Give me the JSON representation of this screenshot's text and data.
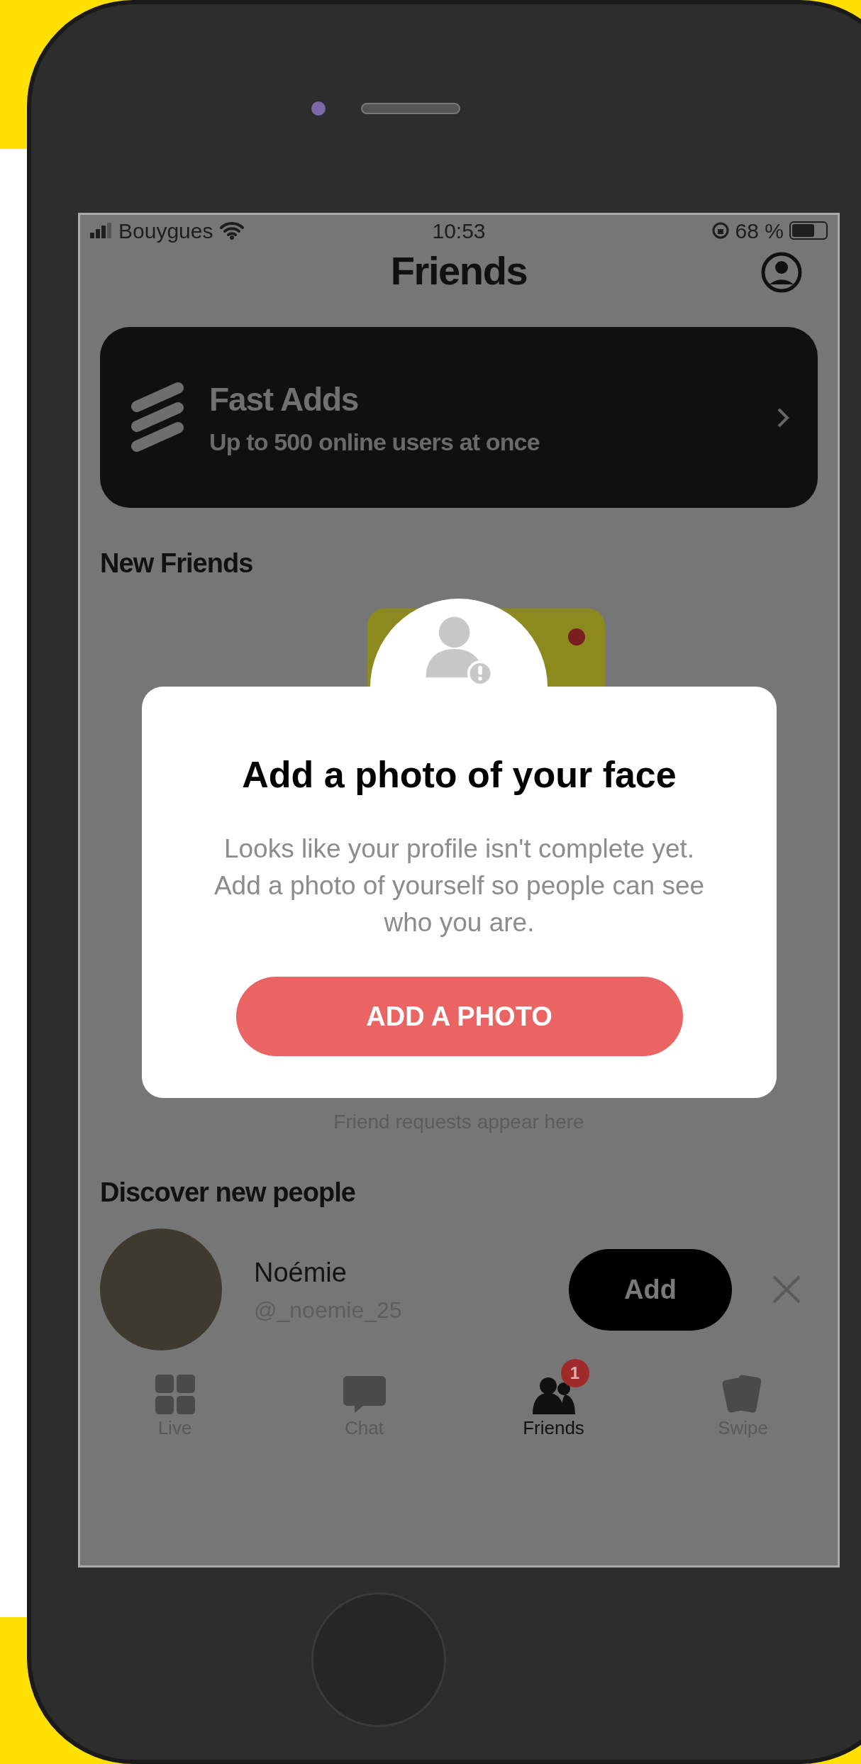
{
  "status_bar": {
    "carrier": "Bouygues",
    "time": "10:53",
    "battery": "68 %"
  },
  "header": {
    "title": "Friends"
  },
  "fast_adds": {
    "title": "Fast Adds",
    "subtitle": "Up to 500 online users at once"
  },
  "new_friends": {
    "heading": "New Friends",
    "empty_text": "Friend requests appear here"
  },
  "modal": {
    "title": "Add a photo of your face",
    "body": "Looks like your profile isn't complete yet. Add a photo of yourself so people can see who you are.",
    "button": "ADD A PHOTO"
  },
  "discover": {
    "heading": "Discover new people",
    "people": [
      {
        "name": "Noémie",
        "handle": "@_noemie_25",
        "button": "Add"
      }
    ]
  },
  "tab_bar": [
    {
      "label": "Live",
      "selected": false
    },
    {
      "label": "Chat",
      "selected": false
    },
    {
      "label": "Friends",
      "selected": true,
      "badge": "1"
    },
    {
      "label": "Swipe",
      "selected": false
    }
  ]
}
